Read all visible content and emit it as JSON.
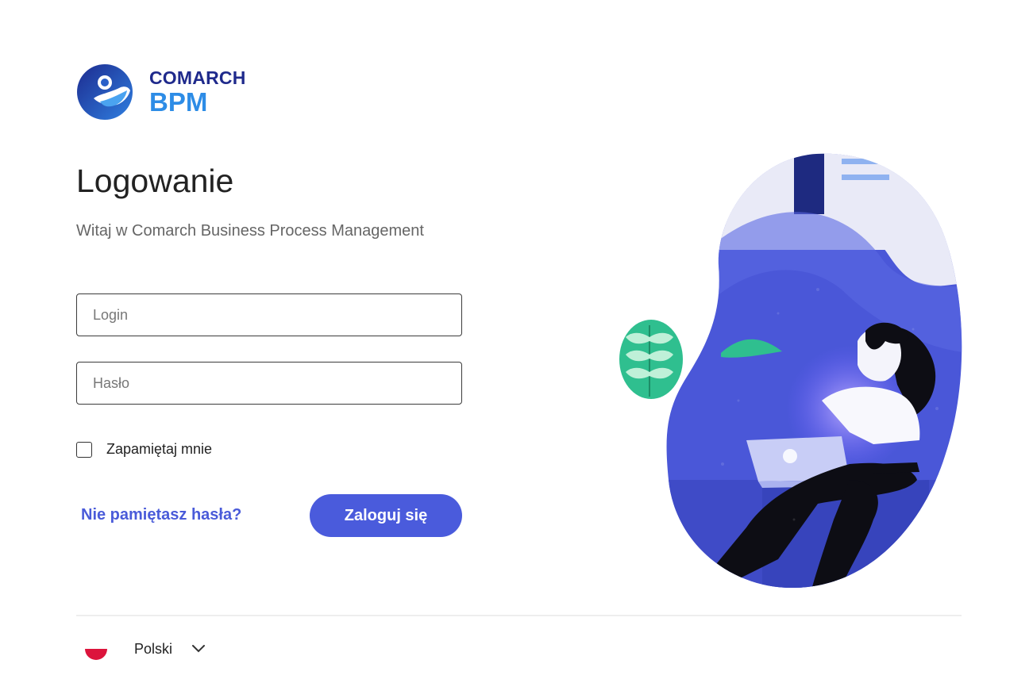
{
  "brand": {
    "company": "COMARCH",
    "product": "BPM",
    "colors": {
      "navy": "#1f2a8c",
      "blue": "#2d8ce6",
      "accent": "#4a5bdc"
    }
  },
  "heading": {
    "title": "Logowanie",
    "subtitle": "Witaj w Comarch Business Process Management"
  },
  "form": {
    "login_placeholder": "Login",
    "login_value": "",
    "password_placeholder": "Hasło",
    "password_value": "",
    "remember_label": "Zapamiętaj mnie",
    "remember_checked": false,
    "forgot_label": "Nie pamiętasz hasła?",
    "submit_label": "Zaloguj się"
  },
  "footer": {
    "language_label": "Polski",
    "language_flag": "poland-flag-icon"
  }
}
